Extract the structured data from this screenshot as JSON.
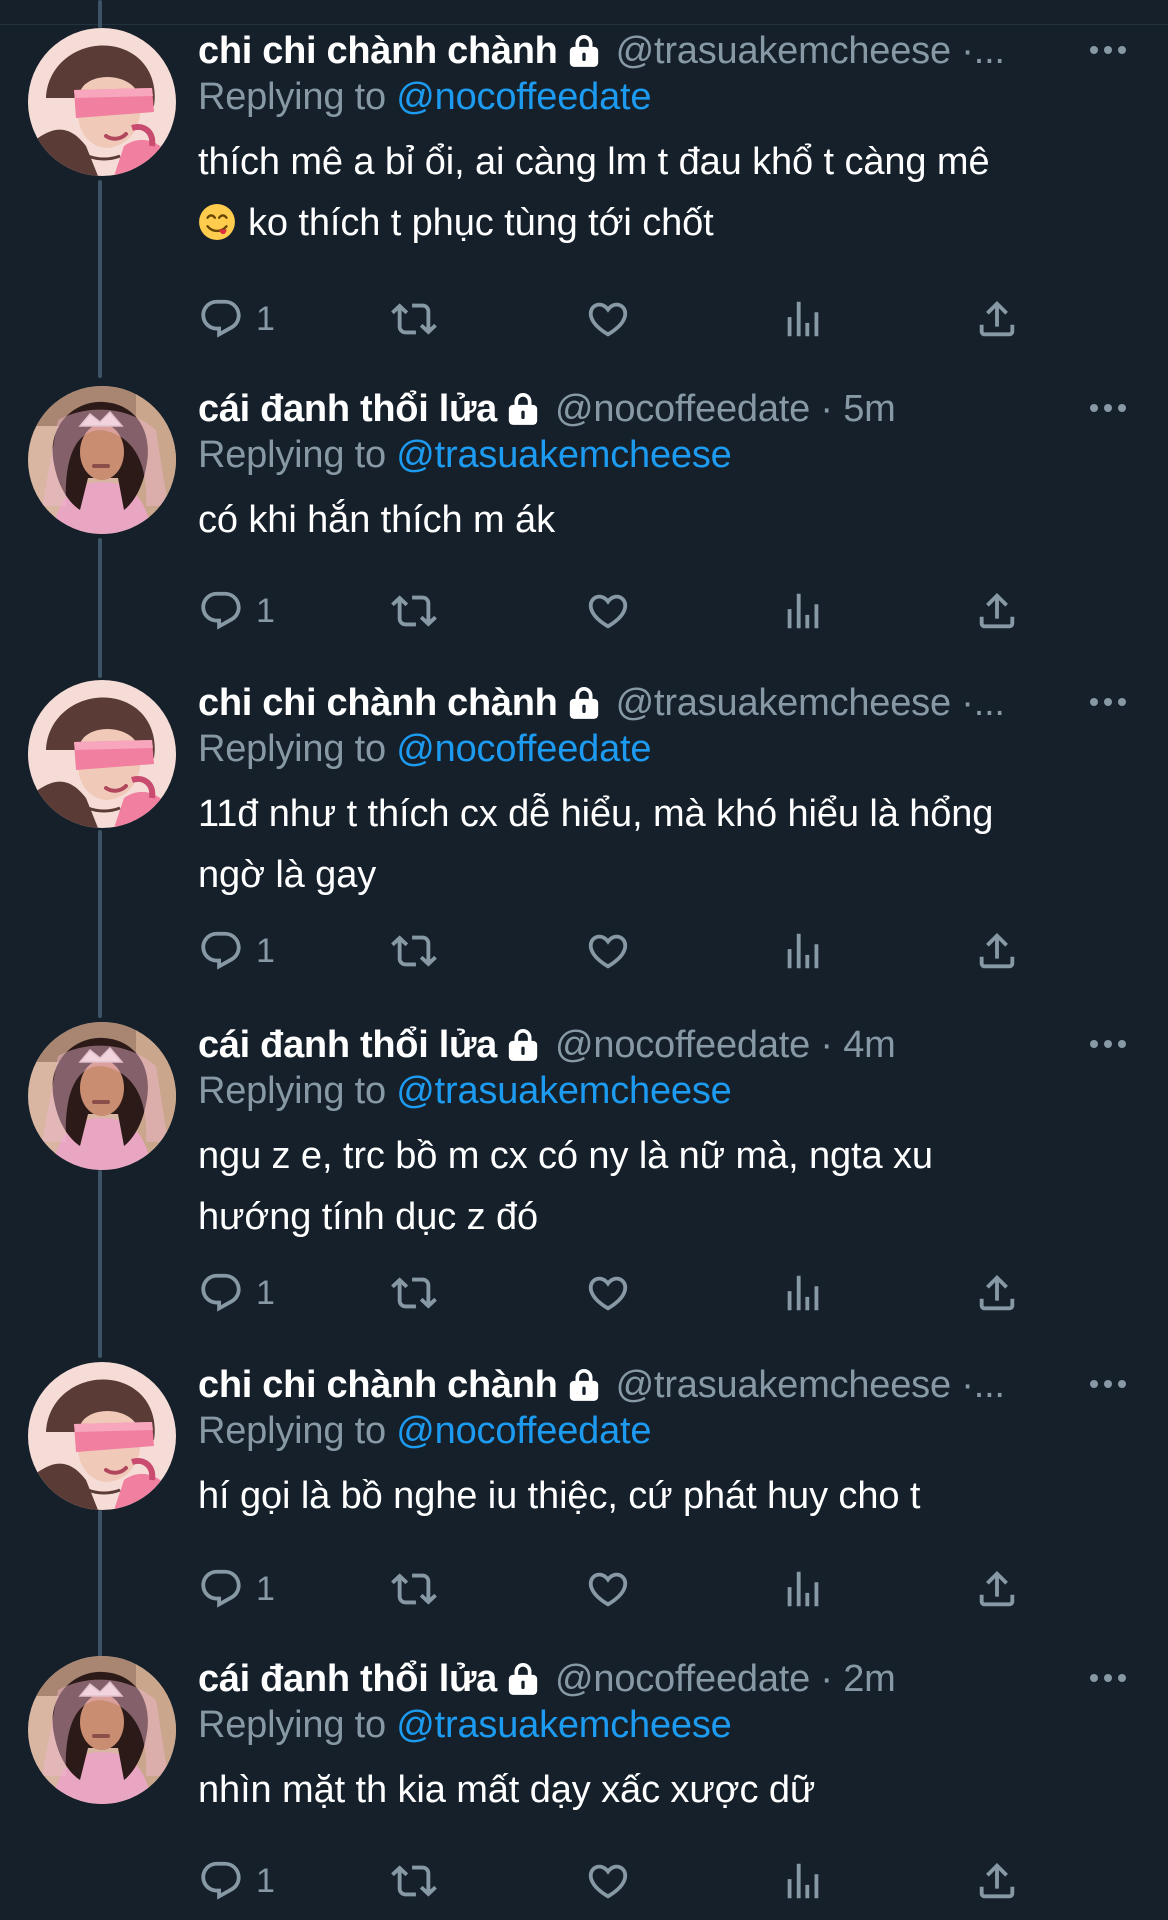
{
  "colors": {
    "background": "#15202b",
    "text_primary": "#ffffff",
    "text_secondary": "#8899a6",
    "mention": "#1d9bf0",
    "thread_line": "#3d5466"
  },
  "icons": {
    "lock": "lock-icon",
    "more": "more-icon",
    "reply": "reply-icon",
    "retweet": "retweet-icon",
    "like": "heart-icon",
    "views": "analytics-icon",
    "share": "share-icon",
    "emoji": "yum-face-emoji"
  },
  "tweets": [
    {
      "author_name": "chi chi chành chành",
      "handle_meta": "@trasuakemcheese ·...",
      "replying_prefix": "Replying to",
      "replying_to": "@nocoffeedate",
      "text_lines": [
        "thích mê a bỉ ổi, ai càng lm t đau khổ t càng mê",
        "ko thích t phục tùng tới chốt"
      ],
      "reply_count": "1"
    },
    {
      "author_name": "cái đanh thổi lửa",
      "handle_meta": "@nocoffeedate · 5m",
      "replying_prefix": "Replying to",
      "replying_to": "@trasuakemcheese",
      "text_lines": [
        "có khi hắn thích m ák"
      ],
      "reply_count": "1"
    },
    {
      "author_name": "chi chi chành chành",
      "handle_meta": "@trasuakemcheese ·...",
      "replying_prefix": "Replying to",
      "replying_to": "@nocoffeedate",
      "text_lines": [
        "11đ như t thích cx dễ hiểu, mà khó hiểu là hổng",
        "ngờ là gay"
      ],
      "reply_count": "1"
    },
    {
      "author_name": "cái đanh thổi lửa",
      "handle_meta": "@nocoffeedate · 4m",
      "replying_prefix": "Replying to",
      "replying_to": "@trasuakemcheese",
      "text_lines": [
        "ngu z e, trc bồ m cx có ny là nữ mà, ngta xu",
        "hướng tính dục z đó"
      ],
      "reply_count": "1"
    },
    {
      "author_name": "chi chi chành chành",
      "handle_meta": "@trasuakemcheese ·...",
      "replying_prefix": "Replying to",
      "replying_to": "@nocoffeedate",
      "text_lines": [
        "hí gọi là bồ nghe iu thiệc, cứ phát huy cho t"
      ],
      "reply_count": "1"
    },
    {
      "author_name": "cái đanh thổi lửa",
      "handle_meta": "@nocoffeedate · 2m",
      "replying_prefix": "Replying to",
      "replying_to": "@trasuakemcheese",
      "text_lines": [
        "nhìn mặt th kia mất dạy xấc xược dữ"
      ],
      "reply_count": "1"
    }
  ]
}
